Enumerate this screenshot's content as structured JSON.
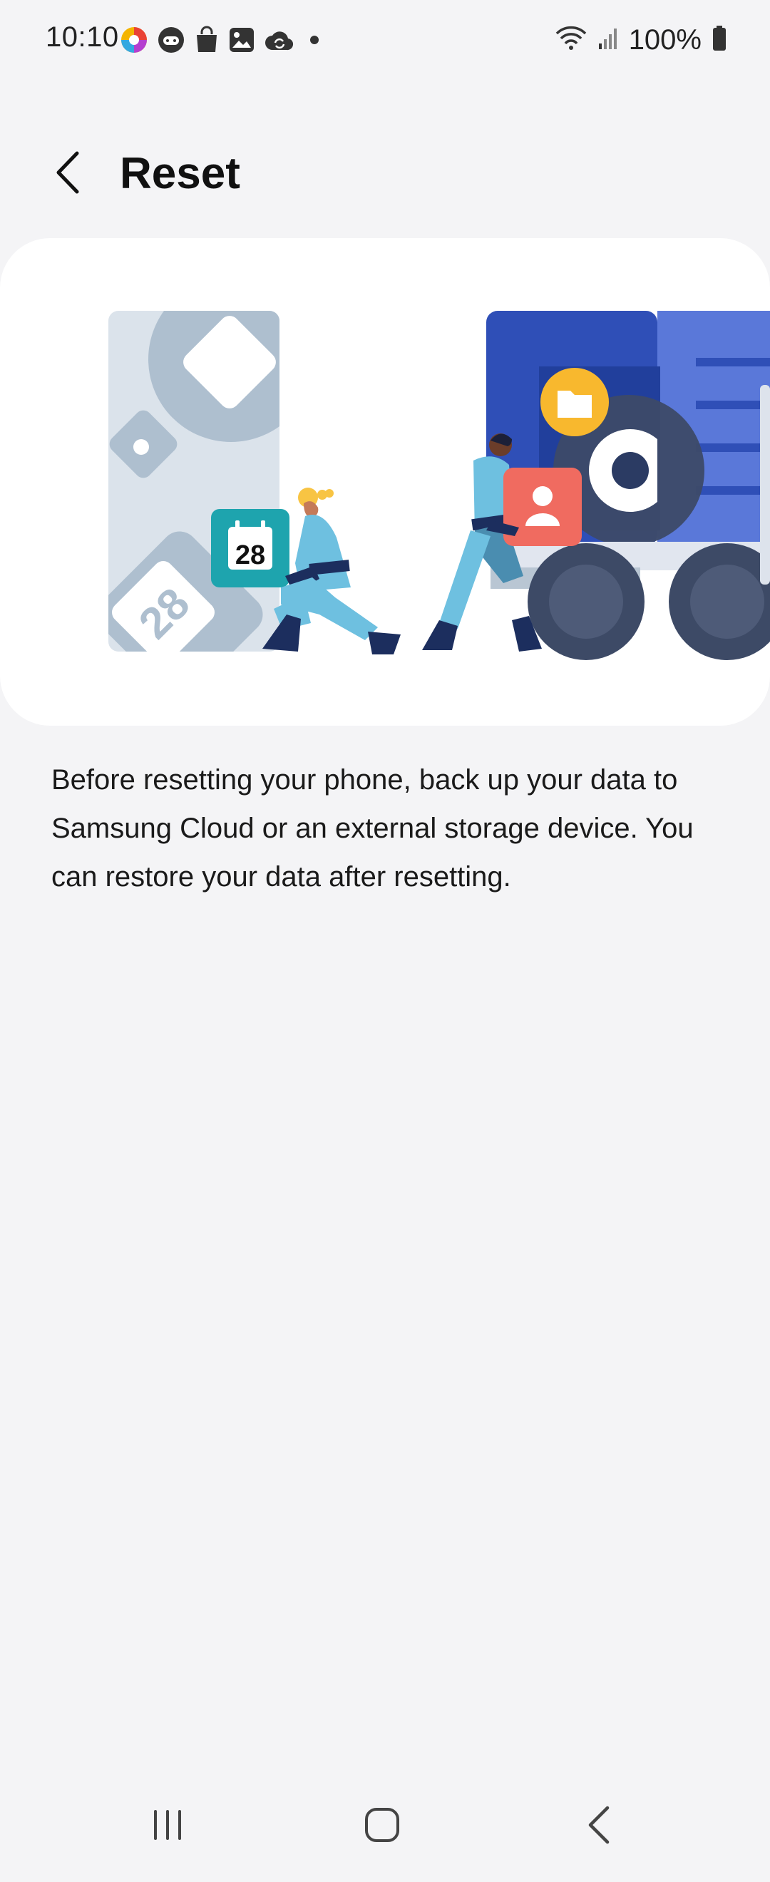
{
  "status_bar": {
    "time": "10:10",
    "battery": "100%",
    "left_icons": [
      "app-colorful-icon",
      "game-icon",
      "shopping-bag-icon",
      "gallery-icon",
      "cloud-sync-icon",
      "dot-icon"
    ],
    "right_icons": [
      "wifi-icon",
      "signal-icon",
      "battery-icon"
    ]
  },
  "header": {
    "title": "Reset",
    "back_icon": "chevron-left-icon"
  },
  "illustration": {
    "calendar_day": "28",
    "calendar_day_large": "28"
  },
  "description": "Before resetting your phone, back up your data to Samsung Cloud or an external storage device. You can restore your data after resetting.",
  "nav_bar": {
    "icons": [
      "recent-apps-icon",
      "home-icon",
      "back-icon"
    ]
  },
  "colors": {
    "background": "#f4f4f6",
    "card": "#ffffff",
    "truck_blue": "#3557c9",
    "teal": "#1ea4ae",
    "coral": "#f06b60",
    "yellow": "#f8b82e"
  }
}
